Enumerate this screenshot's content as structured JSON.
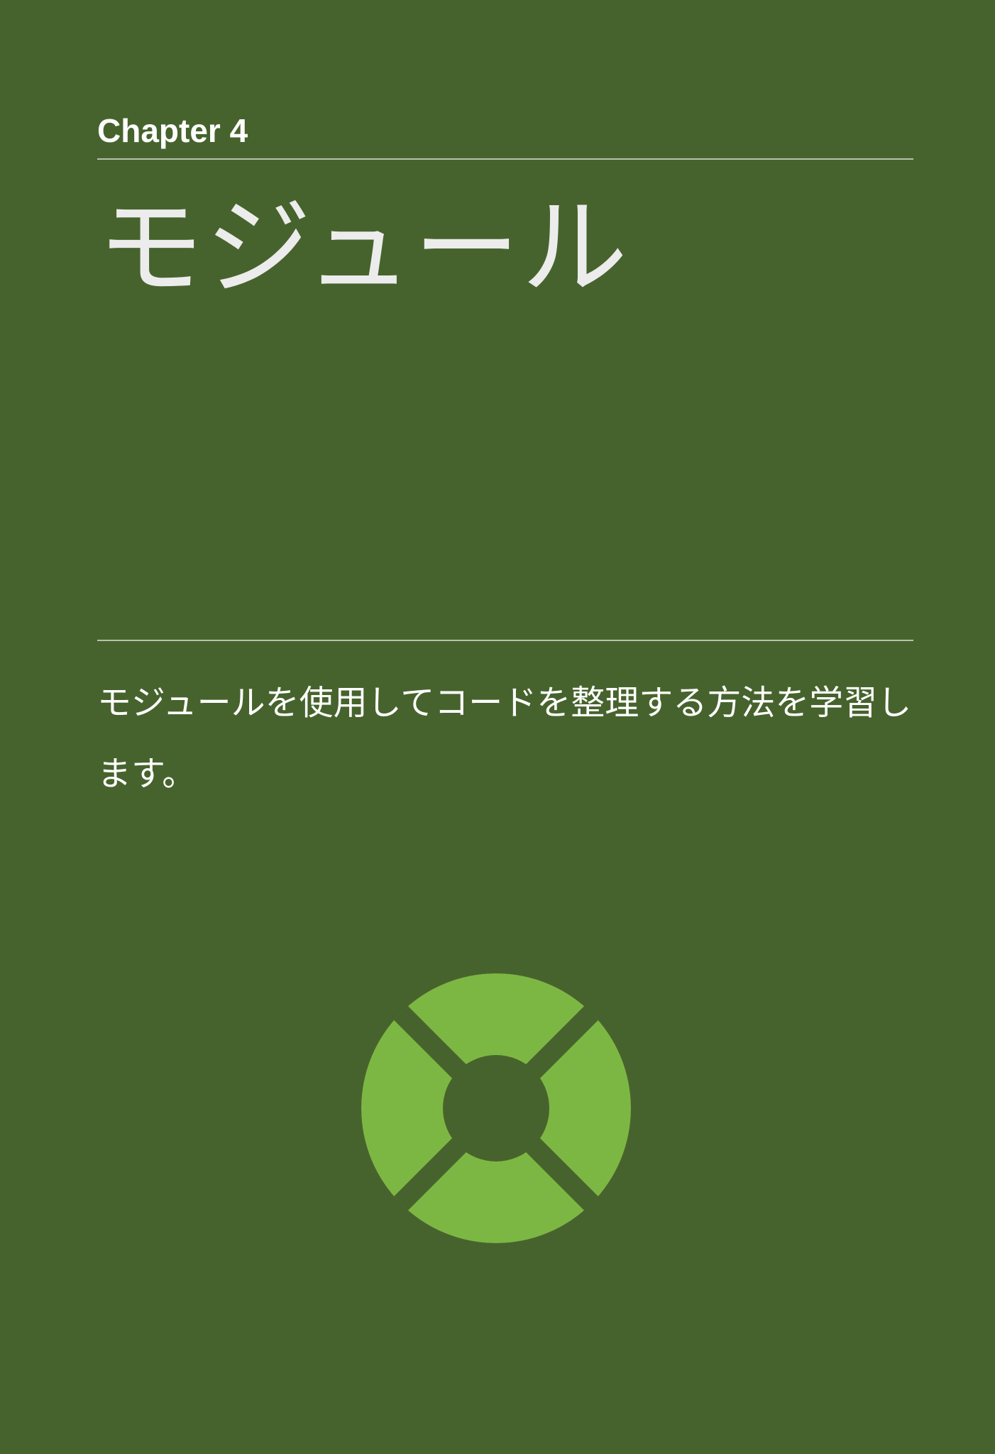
{
  "chapter": {
    "label": "Chapter 4",
    "title": "モジュール",
    "description": "モジュールを使用してコードを整理する方法を学習します。"
  },
  "logo": {
    "icon": "module-emblem-icon",
    "color": "#7db743",
    "background_color": "#47632d"
  },
  "colors": {
    "background": "#47632d",
    "rule": "#b7c2ad",
    "title_text": "#ececec",
    "text": "#ffffff"
  }
}
